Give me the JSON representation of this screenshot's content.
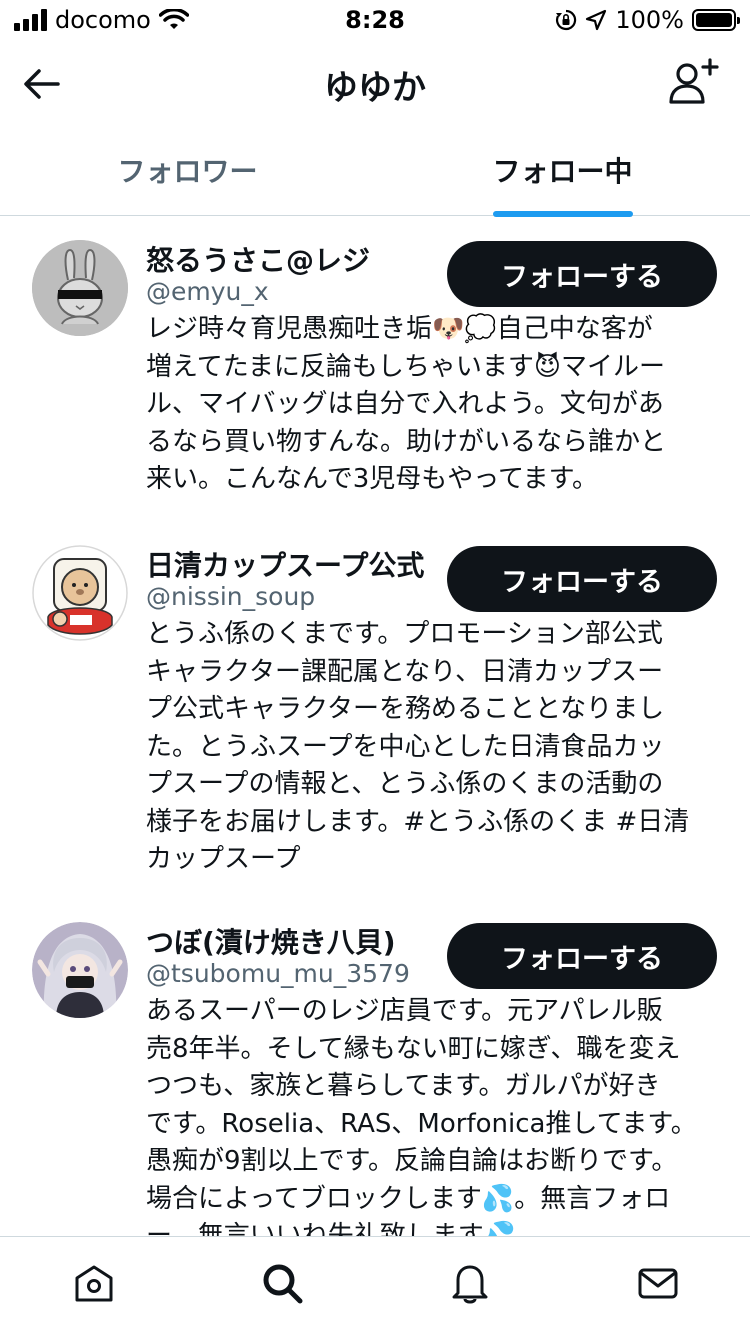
{
  "status_bar": {
    "carrier": "docomo",
    "time": "8:28",
    "battery_percent": "100%",
    "signal_bars": 4,
    "battery_level": 1.0
  },
  "header": {
    "title": "ゆゆか",
    "back_icon": "arrow-left-icon",
    "add_user_icon": "person-add-icon"
  },
  "tabs": [
    {
      "label": "フォロワー",
      "active": false
    },
    {
      "label": "フォロー中",
      "active": true
    }
  ],
  "accent_color": "#1d9bf0",
  "users": [
    {
      "name": "怒るうさこ@レジ",
      "handle": "@emyu_x",
      "follow_label": "フォローする",
      "avatar": "rabbit-avatar-icon",
      "bio": "レジ時々育児愚痴吐き垢🐶💭自己中な客が\n増えてたまに反論もしちゃいます😈マイルー\nル、マイバッグは自分で入れよう。文句があ\nるなら買い物すんな。助けがいるなら誰かと\n来い。こんなんで3児母もやってます。"
    },
    {
      "name": "日清カップスープ公式",
      "handle": "@nissin_soup",
      "follow_label": "フォローする",
      "avatar": "tofu-bear-avatar-icon",
      "bio": "とうふ係のくまです。プロモーション部公式\nキャラクター課配属となり、日清カップスー\nプ公式キャラクターを務めることとなりまし\nた。とうふスープを中心とした日清食品カッ\nプスープの情報と、とうふ係のくまの活動の\n様子をお届けします。#とうふ係のくま #日清\nカップスープ"
    },
    {
      "name": "つぼ(漬け焼き八貝)",
      "handle": "@tsubomu_mu_3579",
      "follow_label": "フォローする",
      "avatar": "anime-girl-avatar-icon",
      "bio": "あるスーパーのレジ店員です。元アパレル販\n売8年半。そして縁もない町に嫁ぎ、職を変え\nつつも、家族と暮らしてます。ガルパが好き\nです。Roselia、RAS、Morfonica推してます。\n愚痴が9割以上です。反論自論はお断りです。\n場合によってブロックします💦。無言フォロ\nー、無言いいね失礼致します💦。"
    }
  ],
  "tab_bar": [
    {
      "icon": "home-icon"
    },
    {
      "icon": "search-icon"
    },
    {
      "icon": "bell-icon"
    },
    {
      "icon": "mail-icon"
    }
  ]
}
